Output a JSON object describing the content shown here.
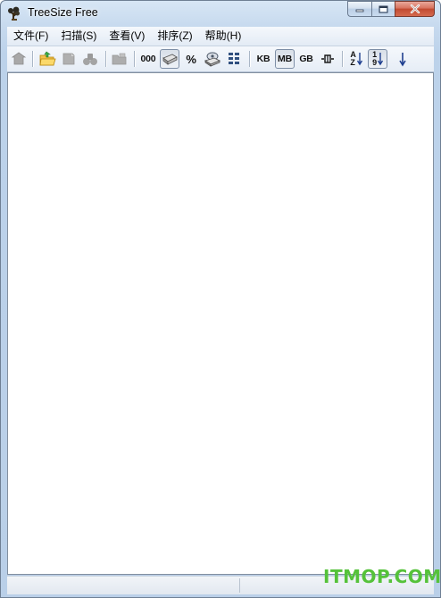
{
  "window": {
    "title": "TreeSize Free"
  },
  "menu": [
    "文件(F)",
    "扫描(S)",
    "查看(V)",
    "排序(Z)",
    "帮助(H)"
  ],
  "toolbar": {
    "count_label": "000",
    "percent_label": "%",
    "kb_label": "KB",
    "mb_label": "MB",
    "gb_label": "GB",
    "sort_az_top": "A",
    "sort_az_bottom": "Z",
    "sort_num_top": "1",
    "sort_num_bottom": "9",
    "pressed_units": "MB"
  },
  "watermark": "ITMOP.COM",
  "colors": {
    "watermark": "#55c23a",
    "close_button": "#c9523a",
    "toolbar_text": "#111111"
  }
}
